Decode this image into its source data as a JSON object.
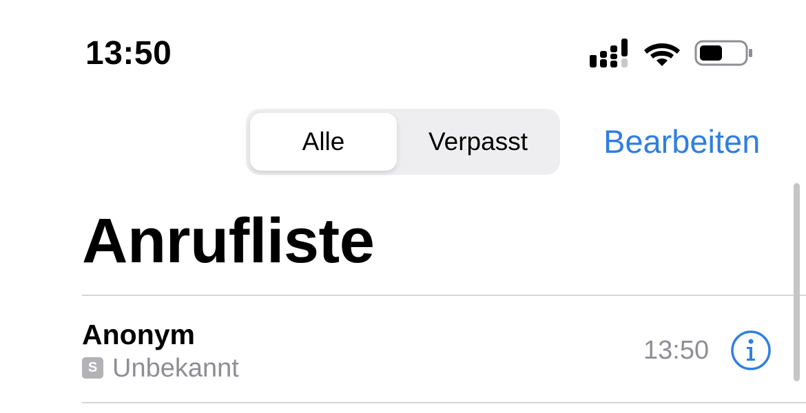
{
  "status_bar": {
    "time": "13:50",
    "icons": [
      "cellular-signal-icon",
      "wifi-icon",
      "battery-icon"
    ]
  },
  "segmented_control": {
    "options": [
      {
        "label": "Alle",
        "selected": true
      },
      {
        "label": "Verpasst",
        "selected": false
      }
    ]
  },
  "nav": {
    "edit_label": "Bearbeiten"
  },
  "page": {
    "title": "Anrufliste"
  },
  "calls": [
    {
      "name": "Anonym",
      "sim_badge": "S",
      "type": "Unbekannt",
      "time": "13:50",
      "action_icon": "info-icon"
    }
  ],
  "colors": {
    "accent": "#2f7fe0",
    "secondary_text": "#8e8e93",
    "segment_bg": "#eeeef0",
    "badge_bg": "#b3b3b6"
  }
}
